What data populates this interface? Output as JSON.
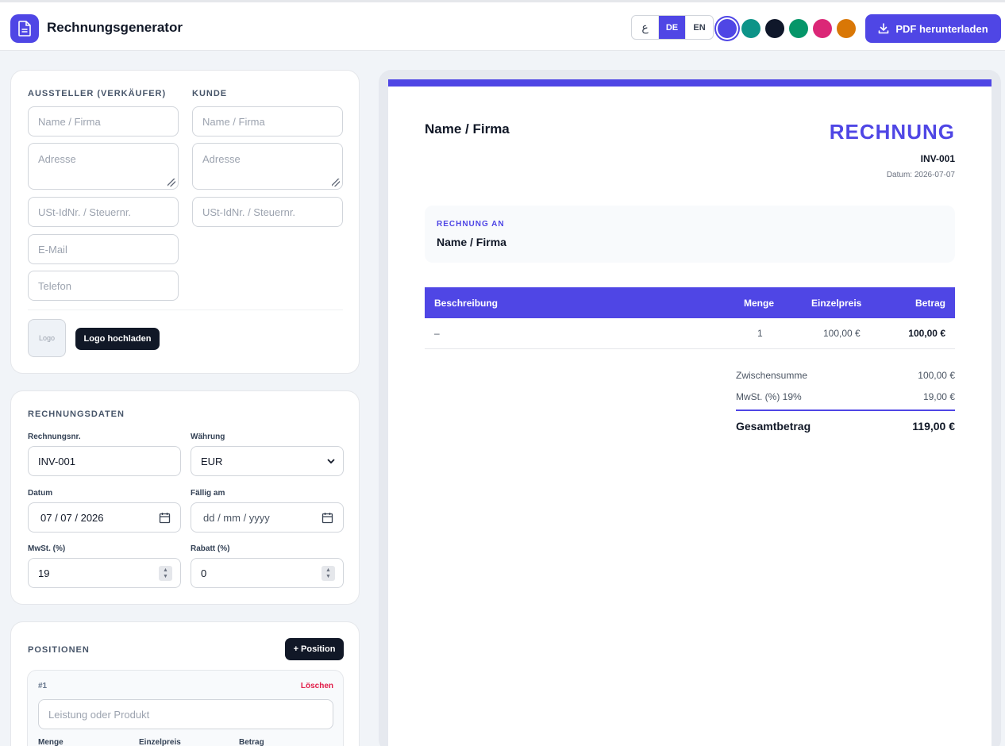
{
  "app": {
    "title": "Rechnungsgenerator",
    "icon": "document-icon"
  },
  "header": {
    "languages": [
      {
        "label": "ع",
        "active": false
      },
      {
        "label": "DE",
        "active": true
      },
      {
        "label": "EN",
        "active": false
      }
    ],
    "theme_colors": [
      "#4f46e5",
      "#0d9488",
      "#0f172a",
      "#059669",
      "#db2777",
      "#d97706"
    ],
    "selected_color": "#4f46e5",
    "pdf_button": "PDF herunterladen"
  },
  "seller": {
    "title": "AUSSTELLER (VERKÄUFER)",
    "name_placeholder": "Name / Firma",
    "address_placeholder": "Adresse",
    "vat_placeholder": "USt-IdNr. / Steuernr.",
    "email_placeholder": "E-Mail",
    "phone_placeholder": "Telefon",
    "logo_placeholder": "Logo",
    "logo_button": "Logo hochladen"
  },
  "customer": {
    "title": "KUNDE",
    "name_placeholder": "Name / Firma",
    "address_placeholder": "Adresse",
    "vat_placeholder": "USt-IdNr. / Steuernr."
  },
  "invoice_data": {
    "title": "RECHNUNGSDATEN",
    "number_label": "Rechnungsnr.",
    "number_value": "INV-001",
    "currency_label": "Währung",
    "currency_value": "EUR",
    "date_label": "Datum",
    "date_value": "07 / 07 / 2026",
    "due_label": "Fällig am",
    "due_placeholder": "dd / mm / yyyy",
    "vat_label": "MwSt. (%)",
    "vat_value": "19",
    "discount_label": "Rabatt (%)",
    "discount_value": "0"
  },
  "positions": {
    "title": "POSITIONEN",
    "add_button": "+ Position",
    "items": [
      {
        "index": "#1",
        "delete": "Löschen",
        "description_placeholder": "Leistung oder Produkt",
        "quantity_label": "Menge",
        "unit_price_label": "Einzelpreis",
        "amount_label": "Betrag"
      }
    ]
  },
  "preview": {
    "seller_name": "Name / Firma",
    "heading": "RECHNUNG",
    "invoice_no": "INV-001",
    "date": "Datum: 2026-07-07",
    "bill_to_label": "RECHNUNG AN",
    "bill_to_name": "Name / Firma",
    "table": {
      "headers": [
        "Beschreibung",
        "Menge",
        "Einzelpreis",
        "Betrag"
      ],
      "rows": [
        [
          "–",
          "1",
          "100,00 €",
          "100,00 €"
        ]
      ]
    },
    "subtotal_label": "Zwischensumme",
    "subtotal_value": "100,00 €",
    "vat_label": "MwSt. (%) 19%",
    "vat_value": "19,00 €",
    "total_label": "Gesamtbetrag",
    "total_value": "119,00 €"
  }
}
